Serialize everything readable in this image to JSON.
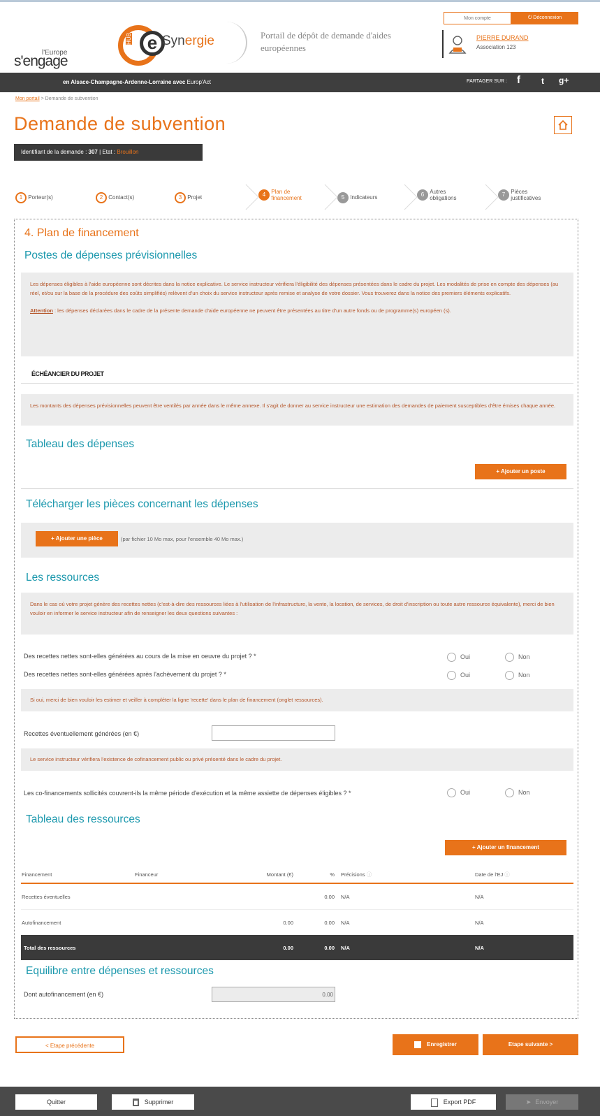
{
  "header": {
    "account_btn": "Mon compte",
    "logout_btn": "Déconnexion",
    "logo_hub": "HUB",
    "logo_e": "e",
    "logo_syn": "Syn",
    "logo_ergie": "ergie",
    "portal_text": "Portail de dépôt de demande d'aides européennes",
    "europe_small": "l'Europe",
    "engage": "s'engage",
    "user_name": "PIERRE DURAND",
    "user_assoc": "Association 123",
    "region": "en Alsace-Champagne-Ardenne-Lorraine avec",
    "europact": "Europ'Act",
    "share_label": "PARTAGER SUR :",
    "social": [
      "f",
      "t",
      "g+"
    ]
  },
  "breadcrumb": {
    "home": "Mon portail",
    "sep": ">",
    "current": "Demande de subvention"
  },
  "page_title": "Demande de subvention",
  "ident": {
    "label": "Identifiant de la demande :",
    "id": "307",
    "etat_label": "| Etat :",
    "etat": "Brouillon"
  },
  "steps": [
    {
      "num": "1",
      "label": "Porteur(s)"
    },
    {
      "num": "2",
      "label": "Contact(s)"
    },
    {
      "num": "3",
      "label": "Projet"
    },
    {
      "num": "4",
      "label": "Plan de financement"
    },
    {
      "num": "5",
      "label": "Indicateurs"
    },
    {
      "num": "6",
      "label": "Autres obligations"
    },
    {
      "num": "7",
      "label": "Pièces justificatives"
    }
  ],
  "section": {
    "title": "4. Plan de financement",
    "postes_title": "Postes de dépenses prévisionnelles",
    "postes_text": "Les dépenses éligibles à l'aide européenne sont décrites dans la notice explicative. Le service instructeur vérifiera l'éligibilité des dépenses présentées dans le cadre du projet. Les modalités de prise en compte des dépenses (au réel, et/ou sur la base de la procédure des coûts simplifiés) relèvent d'un choix du service instructeur après remise et analyse de votre dossier. Vous trouverez dans la notice des premiers éléments explicatifs.",
    "attention_label": "Attention",
    "attention_text": " : les dépenses déclarées dans le cadre de la présente demande d'aide européenne ne peuvent être présentées au titre d'un autre fonds ou de programme(s) européen (s).",
    "echeancier": "ÉCHÉANCIER DU PROJET",
    "echeancier_text": "Les montants des dépenses prévisionnelles peuvent être ventilés par année dans le même annexe. Il s'agit de donner au service instructeur une estimation des demandes de paiement susceptibles d'être émises chaque année.",
    "tableau_depenses": "Tableau des dépenses",
    "ajouter_poste": "+ Ajouter un poste",
    "telecharger_title": "Télécharger les pièces concernant les dépenses",
    "ajouter_piece": "+ Ajouter une pièce",
    "piece_hint": "(par fichier 10 Mo max, pour l'ensemble 40 Mo max.)",
    "ressources_title": "Les ressources",
    "ressources_text": "Dans le cas où votre projet génère des recettes nettes (c'est-à-dire des ressources liées à l'utilisation de l'infrastructure, la vente, la location, de services, de droit d'inscription ou toute autre ressource équivalente), merci de bien vouloir en informer le service instructeur afin de renseigner les deux questions suivantes :",
    "q1": "Des recettes nettes sont-elles générées au cours de la mise en oeuvre du projet ? *",
    "q2": "Des recettes nettes sont-elles générées après l'achèvement du projet ? *",
    "oui": "Oui",
    "non": "Non",
    "si_oui": "Si oui, merci de bien vouloir les estimer et veiller à compléter la ligne 'recette' dans le plan de financement (onglet ressources).",
    "recettes_label": "Recettes éventuellement générées (en €)",
    "recettes_value": "",
    "cofin_info": "Le service instructeur vérifiera l'existence de cofinancement public ou privé présenté dans le cadre du projet.",
    "q3": "Les co-financements sollicités couvrent-ils la même période d'exécution et la même assiette de dépenses éligibles ? *",
    "tableau_ressources": "Tableau des ressources",
    "ajouter_financement": "+ Ajouter un financement",
    "table": {
      "headers": [
        "Financement",
        "Financeur",
        "Montant (€)",
        "%",
        "Précisions",
        "Date de l'EJ"
      ],
      "rows": [
        [
          "Recettes éventuelles",
          "",
          "",
          "0.00",
          "N/A",
          "N/A"
        ],
        [
          "Autofinancement",
          "",
          "0.00",
          "0.00",
          "N/A",
          "N/A"
        ]
      ],
      "total": [
        "Total des ressources",
        "",
        "0.00",
        "0.00",
        "N/A",
        "N/A"
      ]
    },
    "equilibre_title": "Equilibre entre dépenses et ressources",
    "autofin_label": "Dont autofinancement (en €)",
    "autofin_value": "0.00"
  },
  "nav": {
    "prev": "< Etape précédente",
    "save": "Enregistrer",
    "next": "Etape suivante >"
  },
  "footer": {
    "quit": "Quitter",
    "delete": "Supprimer",
    "export": "Export PDF",
    "send": "Envoyer"
  },
  "colors": {
    "accent": "#e8731a",
    "teal": "#1b98ad",
    "dark": "#3a3a3a"
  }
}
